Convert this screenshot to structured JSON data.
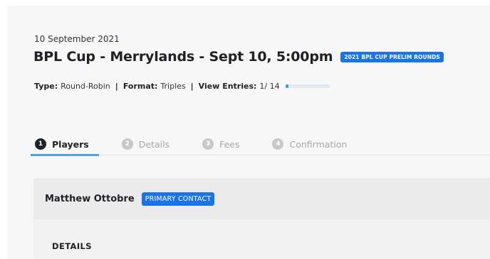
{
  "event": {
    "date": "10 September 2021",
    "title": "BPL Cup - Merrylands - Sept 10, 5:00pm",
    "badge": "2021 BPL CUP PRELIM ROUNDS",
    "badge_color": "#1a73e8"
  },
  "meta": {
    "type_label": "Type:",
    "type_value": "Round-Robin",
    "format_label": "Format:",
    "format_value": "Triples",
    "entries_label": "View Entries:",
    "entries_value": "1/ 14",
    "entries_progress": 0.07,
    "separator": "|"
  },
  "tabs": [
    {
      "number": "1",
      "label": "Players",
      "active": true
    },
    {
      "number": "2",
      "label": "Details",
      "active": false
    },
    {
      "number": "3",
      "label": "Fees",
      "active": false
    },
    {
      "number": "4",
      "label": "Confirmation",
      "active": false
    }
  ],
  "player": {
    "name": "Matthew Ottobre",
    "badge": "PRIMARY CONTACT"
  },
  "section": {
    "details_label": "DETAILS"
  },
  "colors": {
    "accent": "#1a73e8",
    "progress": "#29a8e0",
    "tab_underline": "#4da3ea"
  }
}
